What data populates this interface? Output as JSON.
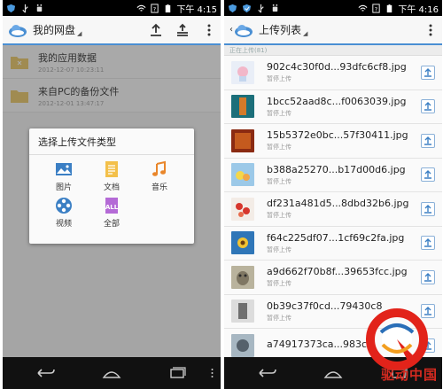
{
  "left_phone": {
    "status": {
      "time": "下午 4:15"
    },
    "actionbar": {
      "title": "我的网盘"
    },
    "files": [
      {
        "name": "我的应用数据",
        "date": "2012-12-07  10:23:11"
      },
      {
        "name": "来自PC的备份文件",
        "date": "2012-12-01  13:47:17"
      }
    ],
    "dialog": {
      "title": "选择上传文件类型",
      "options": [
        {
          "label": "图片",
          "icon": "image-icon"
        },
        {
          "label": "文档",
          "icon": "document-icon"
        },
        {
          "label": "音乐",
          "icon": "music-icon"
        },
        {
          "label": "视频",
          "icon": "video-icon"
        },
        {
          "label": "全部",
          "icon": "all-files-icon"
        }
      ]
    }
  },
  "right_phone": {
    "status": {
      "time": "下午 4:16"
    },
    "actionbar": {
      "title": "上传列表"
    },
    "section_header": "正在上传(81)",
    "uploads": [
      {
        "name": "902c4c30f0d...93dfc6cf8.jpg",
        "status": "暂停上传"
      },
      {
        "name": "1bcc52aad8c...f0063039.jpg",
        "status": "暂停上传"
      },
      {
        "name": "15b5372e0bc...57f30411.jpg",
        "status": "暂停上传"
      },
      {
        "name": "b388a25270...b17d00d6.jpg",
        "status": "暂停上传"
      },
      {
        "name": "df231a481d5...8dbd32b6.jpg",
        "status": "暂停上传"
      },
      {
        "name": "f64c225df07...1cf69c2fa.jpg",
        "status": "暂停上传"
      },
      {
        "name": "a9d662f70b8f...39653fcc.jpg",
        "status": "暂停上传"
      },
      {
        "name": "0b39c37f0cd...79430c8",
        "status": "暂停上传"
      },
      {
        "name": "a74917373ca...983c",
        "status": ""
      }
    ]
  },
  "watermark": {
    "text": "驱动中国"
  },
  "colors": {
    "accent": "#4a8fd3",
    "overlay": "#595959",
    "watermark_red": "#d62a20"
  }
}
